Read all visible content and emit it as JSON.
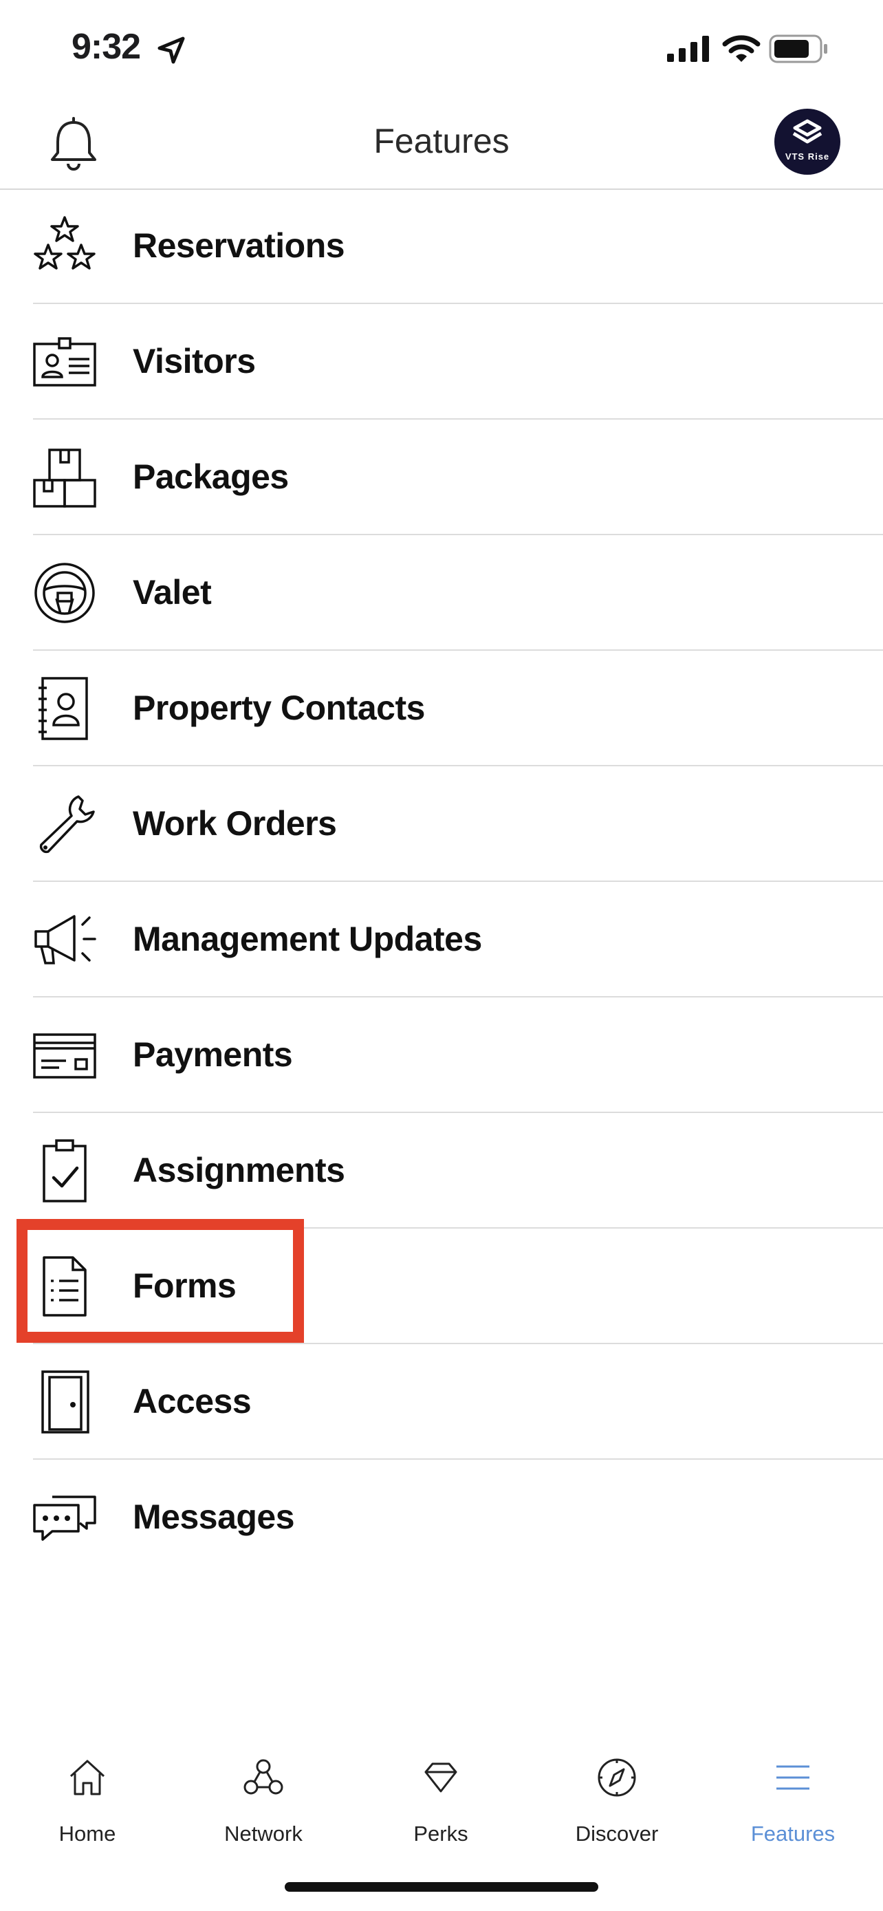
{
  "status_bar": {
    "time": "9:32"
  },
  "header": {
    "title": "Features",
    "avatar_text": "VTS Rise"
  },
  "features": [
    {
      "label": "Reservations",
      "icon": "stars-icon"
    },
    {
      "label": "Visitors",
      "icon": "id-badge-icon"
    },
    {
      "label": "Packages",
      "icon": "boxes-icon"
    },
    {
      "label": "Valet",
      "icon": "steering-wheel-icon"
    },
    {
      "label": "Property Contacts",
      "icon": "contact-book-icon"
    },
    {
      "label": "Work Orders",
      "icon": "wrench-icon"
    },
    {
      "label": "Management Updates",
      "icon": "megaphone-icon"
    },
    {
      "label": "Payments",
      "icon": "credit-card-icon"
    },
    {
      "label": "Assignments",
      "icon": "clipboard-check-icon"
    },
    {
      "label": "Forms",
      "icon": "document-icon"
    },
    {
      "label": "Access",
      "icon": "door-icon"
    },
    {
      "label": "Messages",
      "icon": "chat-bubbles-icon"
    }
  ],
  "highlighted_item": "Forms",
  "highlight_color": "#e4412a",
  "tab_bar": {
    "tabs": [
      {
        "label": "Home",
        "icon": "house-icon"
      },
      {
        "label": "Network",
        "icon": "network-nodes-icon"
      },
      {
        "label": "Perks",
        "icon": "diamond-icon"
      },
      {
        "label": "Discover",
        "icon": "compass-icon"
      },
      {
        "label": "Features",
        "icon": "menu-lines-icon"
      }
    ],
    "active": "Features",
    "active_color": "#5b8fd6"
  }
}
